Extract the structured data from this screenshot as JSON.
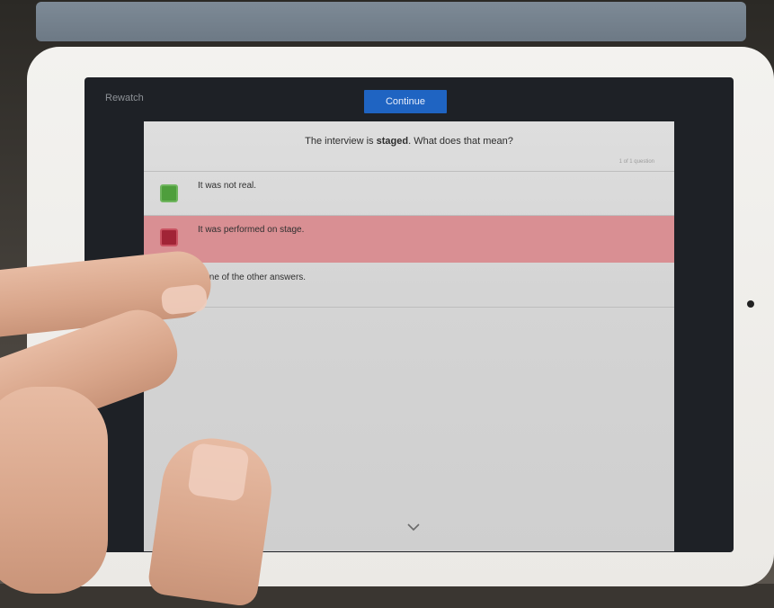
{
  "app": {
    "rewatch_label": "Rewatch",
    "continue_label": "Continue"
  },
  "quiz": {
    "question_prefix": "The interview is ",
    "question_emphasis": "staged",
    "question_suffix": ". What does that mean?",
    "progress": "1 of 1 question",
    "answers": [
      {
        "label": "It was not real.",
        "state": "correct"
      },
      {
        "label": "It was performed on stage.",
        "state": "incorrect-selected"
      },
      {
        "label": "None of the other answers.",
        "state": "unselected"
      }
    ],
    "expand_icon": "chevron-down-icon"
  },
  "colors": {
    "continue_button": "#1f64c2",
    "correct": "#4e9e3c",
    "incorrect": "#a12436",
    "incorrect_row": "#d98f93"
  }
}
